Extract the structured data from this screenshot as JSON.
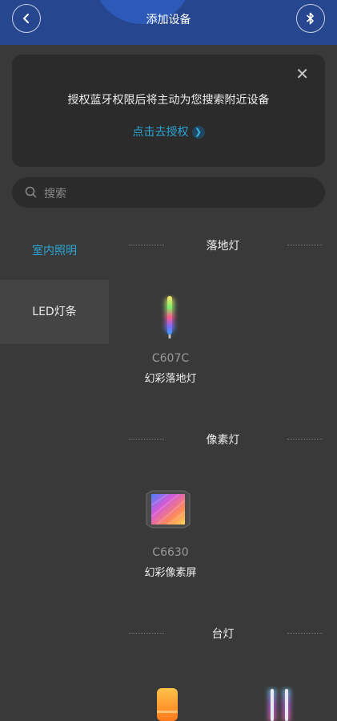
{
  "header": {
    "title": "添加设备",
    "back_icon": "chevron-left-icon",
    "bluetooth_icon": "bluetooth-icon"
  },
  "banner": {
    "message": "授权蓝牙权限后将主动为您搜索附近设备",
    "action": "点击去授权",
    "close": "✕"
  },
  "search": {
    "placeholder": "搜索"
  },
  "sidebar": {
    "items": [
      {
        "label": "室内照明",
        "selected": true
      },
      {
        "label": "LED灯条",
        "selected": false
      }
    ]
  },
  "sections": [
    {
      "title": "落地灯",
      "products": [
        {
          "model": "C607C",
          "name": "幻彩落地灯"
        }
      ]
    },
    {
      "title": "像素灯",
      "products": [
        {
          "model": "C6630",
          "name": "幻彩像素屏"
        }
      ]
    },
    {
      "title": "台灯"
    }
  ],
  "colors": {
    "accent": "#2aa6d6",
    "header_bg": "#26468f",
    "sheet_bg": "#393939",
    "card_bg": "#2b2b2b"
  }
}
